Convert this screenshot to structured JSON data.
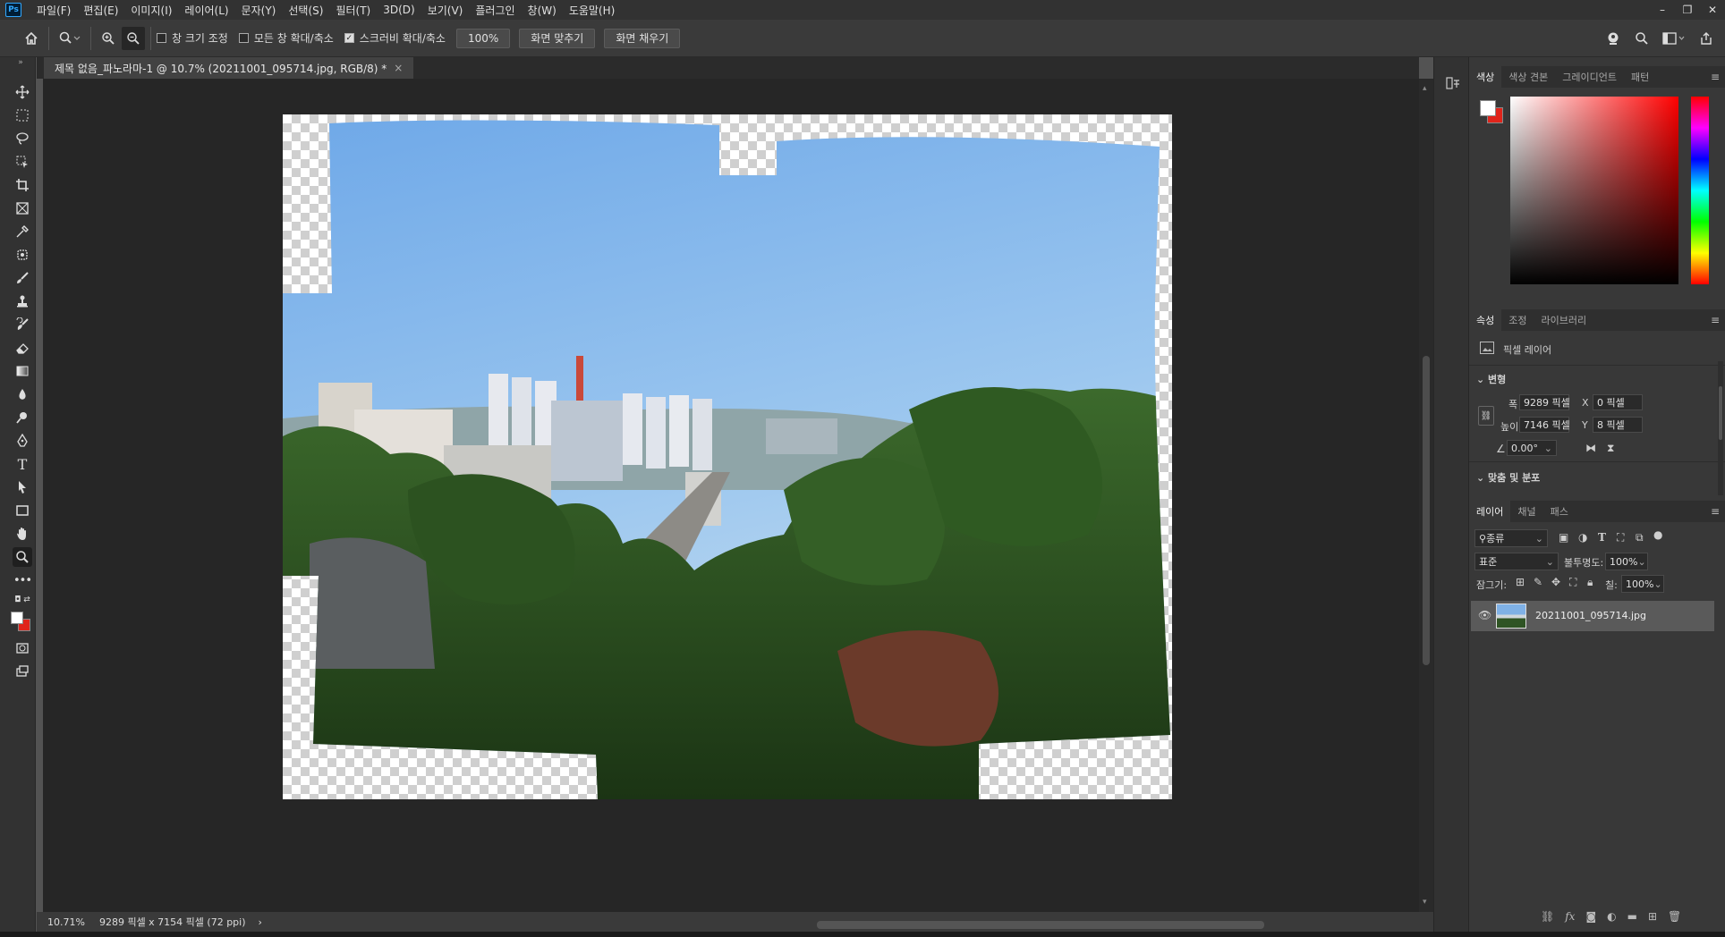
{
  "menubar": {
    "logo": "Ps",
    "items": [
      "파일(F)",
      "편집(E)",
      "이미지(I)",
      "레이어(L)",
      "문자(Y)",
      "선택(S)",
      "필터(T)",
      "3D(D)",
      "보기(V)",
      "플러그인",
      "창(W)",
      "도움말(H)"
    ],
    "window_controls": [
      "–",
      "❐",
      "✕"
    ]
  },
  "options": {
    "home_icon": "home-icon",
    "zoom_icon": "zoom-tool-icon",
    "resize_windows": {
      "label": "창 크기 조정",
      "checked": false
    },
    "zoom_all_windows": {
      "label": "모든 창 확대/축소",
      "checked": false
    },
    "scrubby_zoom": {
      "label": "스크러비 확대/축소",
      "checked": true
    },
    "zoom_100": "100%",
    "fit_screen": "화면 맞추기",
    "fill_screen": "화면 채우기"
  },
  "document": {
    "tab_title": "제목 없음_파노라마-1 @ 10.7% (20211001_095714.jpg, RGB/8) *",
    "close": "×"
  },
  "status": {
    "zoom": "10.71%",
    "doc_info": "9289 픽셀 x 7154 픽셀 (72 ppi)",
    "arrow": "›"
  },
  "color_panel": {
    "tabs": [
      "색상",
      "색상 견본",
      "그레이디언트",
      "패턴"
    ],
    "foreground": "#ffffff",
    "background": "#e0241b",
    "hue": "#ff0000"
  },
  "properties_panel": {
    "tabs": [
      "속성",
      "조정",
      "라이브러리"
    ],
    "layer_type": "픽셀 레이어",
    "transform_section": "변형",
    "width_label": "폭",
    "width_value": "9289 픽셀",
    "height_label": "높이",
    "height_value": "7146 픽셀",
    "x_label": "X",
    "x_value": "0 픽셀",
    "y_label": "Y",
    "y_value": "8 픽셀",
    "angle_value": "0.00°",
    "align_section": "맞춤 및 분포"
  },
  "layers_panel": {
    "tabs": [
      "레이어",
      "채널",
      "패스"
    ],
    "filter_kind": "종류",
    "blend_mode": "표준",
    "opacity_label": "불투명도:",
    "opacity_value": "100%",
    "lock_label": "잠그기:",
    "fill_label": "칠:",
    "fill_value": "100%",
    "layer_name": "20211001_095714.jpg",
    "footer_icons": [
      "link-icon",
      "fx-icon",
      "mask-icon",
      "adjustment-icon",
      "folder-icon",
      "new-layer-icon",
      "trash-icon"
    ],
    "footer_fx": "fx"
  }
}
